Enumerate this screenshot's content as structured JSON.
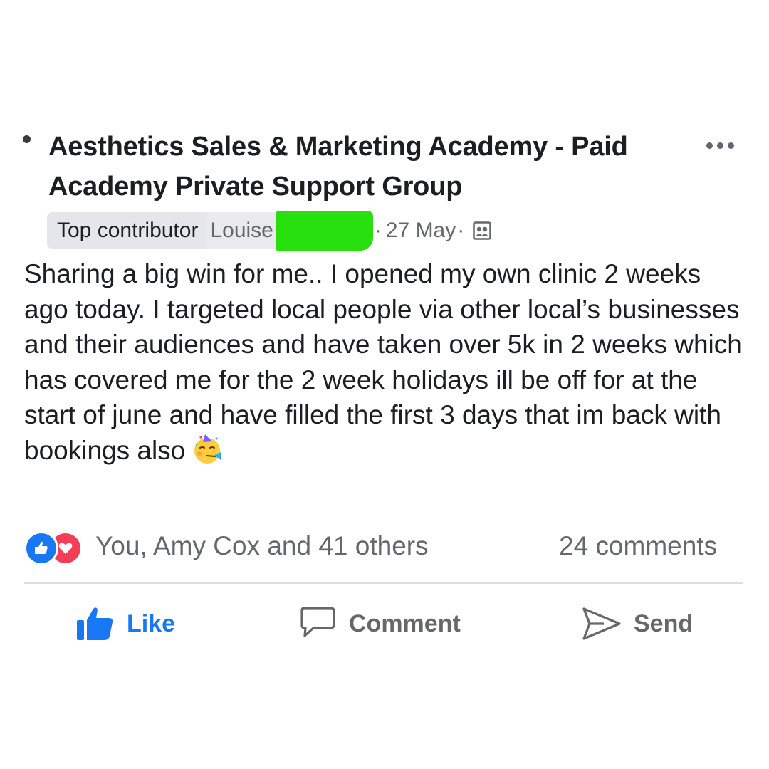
{
  "post": {
    "group_name": "Aesthetics Sales & Marketing Academy - Paid Academy Private Support Group",
    "badge": "Top contributor",
    "author": "Louise",
    "separator": "·",
    "date": "27 May",
    "privacy_icon": "members-icon",
    "body": "Sharing a big win for me.. I opened my own clinic 2 weeks ago today. I targeted local people via other local’s businesses and their audiences and have taken over 5k in 2 weeks which has covered me for the 2 week holidays ill be off for at the start of june and have filled the first 3 days that im back with bookings also",
    "emoji": "partying-face"
  },
  "reactions": {
    "icons": [
      "like-icon",
      "love-icon"
    ],
    "summary": "You, Amy Cox and 41 others",
    "comments": "24 comments"
  },
  "actions": {
    "like": "Like",
    "comment": "Comment",
    "send": "Send"
  },
  "colors": {
    "accent": "#1877f2",
    "love": "#f33e58",
    "muted": "#65676b",
    "redaction": "#29e00f"
  }
}
